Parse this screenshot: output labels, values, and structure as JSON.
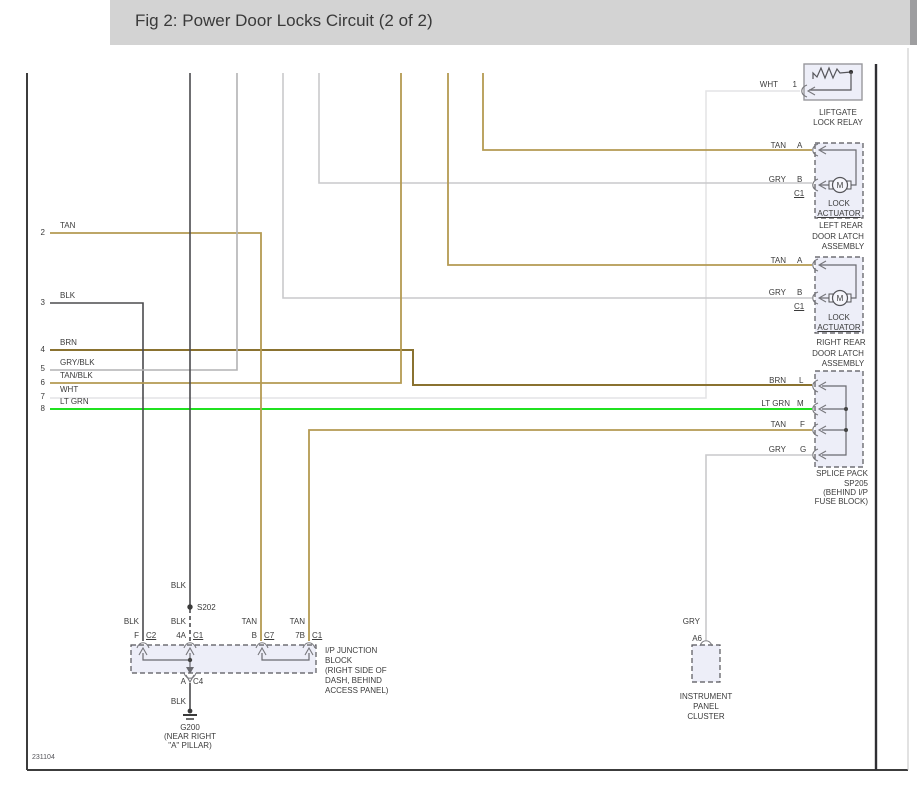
{
  "header": {
    "title": "Fig 2: Power Door Locks Circuit (2 of 2)"
  },
  "canvas": {
    "figure_code": "231104"
  },
  "colors": {
    "tan": "#b49a52",
    "brn": "#8a7230",
    "gry": "#c9c9cb",
    "gry_blk": "#b2b2b4",
    "wht": "#e4e4e6",
    "lt_grn": "#00dd00",
    "blk": "#4b4b4e",
    "internal": "#55555a"
  },
  "left_connector_pins": [
    {
      "num": "2",
      "wire": "TAN"
    },
    {
      "num": "3",
      "wire": "BLK"
    },
    {
      "num": "4",
      "wire": "BRN"
    },
    {
      "num": "5",
      "wire": "GRY/BLK"
    },
    {
      "num": "6",
      "wire": "TAN/BLK"
    },
    {
      "num": "7",
      "wire": "WHT"
    },
    {
      "num": "8",
      "wire": "LT GRN"
    }
  ],
  "liftgate_relay": {
    "wire": "WHT",
    "pin": "1",
    "name": [
      "LIFTGATE",
      "LOCK RELAY"
    ]
  },
  "left_rear_latch": {
    "wire_a": "TAN",
    "pin_a": "A",
    "wire_b": "GRY",
    "pin_b": "B",
    "conn": "C1",
    "motor": "M",
    "part": [
      "LOCK",
      "ACTUATOR"
    ],
    "name": [
      "LEFT REAR",
      "DOOR LATCH",
      "ASSEMBLY"
    ]
  },
  "right_rear_latch": {
    "wire_a": "TAN",
    "pin_a": "A",
    "wire_b": "GRY",
    "pin_b": "B",
    "conn": "C1",
    "motor": "M",
    "part": [
      "LOCK",
      "ACTUATOR"
    ],
    "name": [
      "RIGHT REAR",
      "DOOR LATCH",
      "ASSEMBLY"
    ]
  },
  "splice_pack": {
    "wire_l": "BRN",
    "pin_l": "L",
    "wire_m": "LT GRN",
    "pin_m": "M",
    "wire_f": "TAN",
    "pin_f": "F",
    "wire_g": "GRY",
    "pin_g": "G",
    "name": [
      "SPLICE PACK",
      "SP205",
      "(BEHIND I/P",
      "FUSE BLOCK)"
    ]
  },
  "junction_block": {
    "wire_f": "BLK",
    "pin_f": "F",
    "conn_f": "C2",
    "wire_4a": "BLK",
    "pin_4a": "4A",
    "conn_4a": "C1",
    "wire_b": "TAN",
    "pin_b": "B",
    "conn_b": "C7",
    "wire_7b": "TAN",
    "pin_7b": "7B",
    "conn_7b": "C1",
    "pin_a": "A",
    "conn_a": "C4",
    "name": [
      "I/P JUNCTION",
      "BLOCK",
      "(RIGHT SIDE OF",
      "DASH, BEHIND",
      "ACCESS PANEL)"
    ]
  },
  "s202": {
    "wire": "BLK",
    "label": "S202"
  },
  "g200": {
    "wire": "BLK",
    "name": [
      "G200",
      "(NEAR RIGHT",
      "\"A\" PILLAR)"
    ]
  },
  "instrument_cluster": {
    "wire": "GRY",
    "pin": "A6",
    "name": [
      "INSTRUMENT",
      "PANEL",
      "CLUSTER"
    ]
  }
}
